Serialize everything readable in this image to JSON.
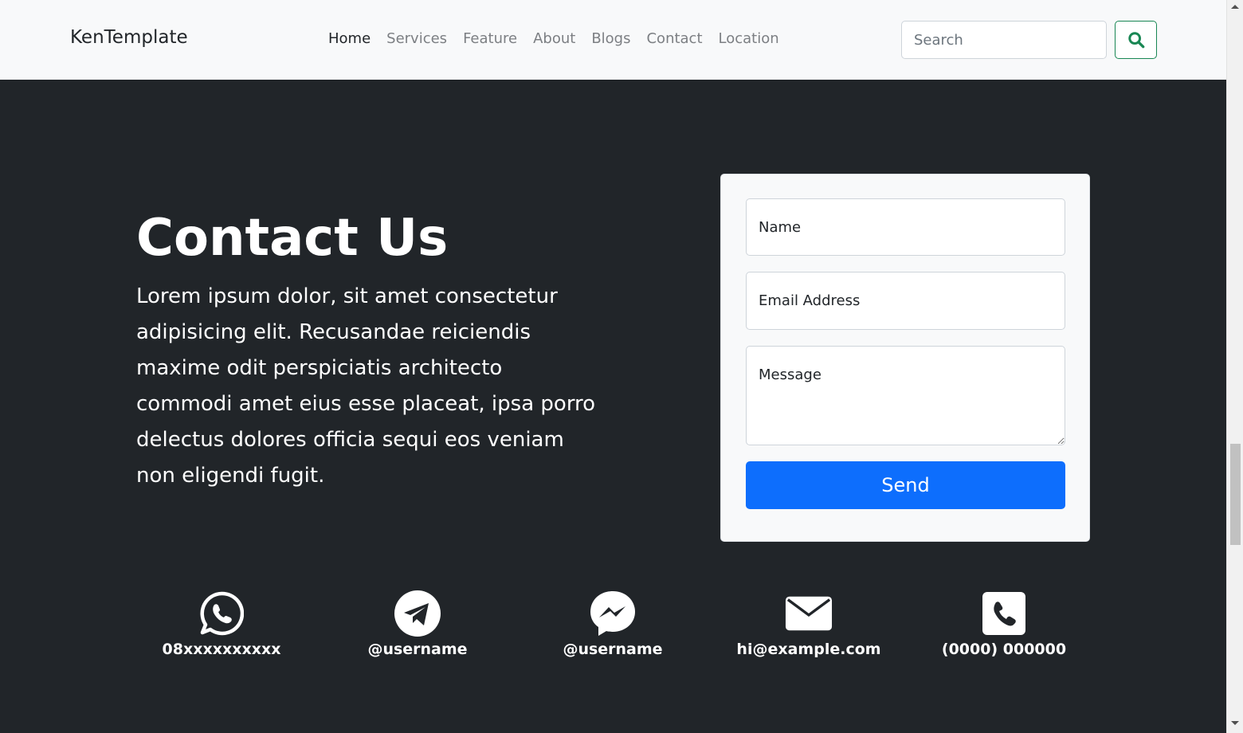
{
  "navbar": {
    "brand": "KenTemplate",
    "links": [
      "Home",
      "Services",
      "Feature",
      "About",
      "Blogs",
      "Contact",
      "Location"
    ],
    "active_index": 0,
    "search_placeholder": "Search"
  },
  "contact": {
    "title": "Contact Us",
    "description": "Lorem ipsum dolor, sit amet consectetur adipisicing elit. Recusandae reiciendis maxime odit perspiciatis architecto commodi amet eius esse placeat, ipsa porro delectus dolores officia sequi eos veniam non eligendi fugit."
  },
  "form": {
    "name_placeholder": "Name",
    "email_placeholder": "Email Address",
    "message_placeholder": "Message",
    "send_label": "Send"
  },
  "channels": [
    {
      "icon": "whatsapp-icon",
      "label": "08xxxxxxxxxx"
    },
    {
      "icon": "telegram-icon",
      "label": "@username"
    },
    {
      "icon": "messenger-icon",
      "label": "@username"
    },
    {
      "icon": "envelope-icon",
      "label": "hi@example.com"
    },
    {
      "icon": "phone-icon",
      "label": "(0000) 000000"
    }
  ],
  "colors": {
    "navbar_bg": "#f8f9fa",
    "page_bg": "#212529",
    "primary": "#0d6efd",
    "success": "#198754"
  }
}
